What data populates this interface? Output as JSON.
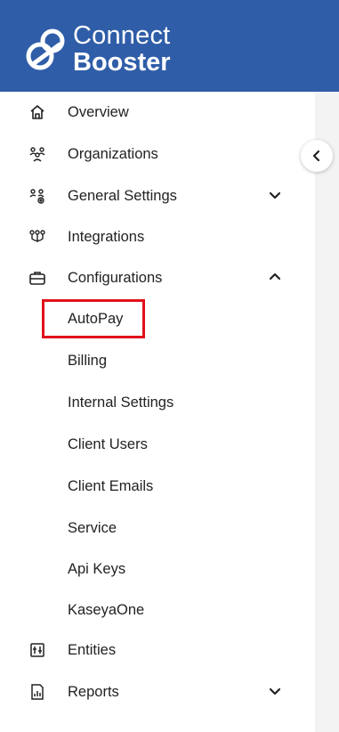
{
  "brand": {
    "line1": "Connect",
    "line2": "Booster"
  },
  "nav": {
    "overview": "Overview",
    "organizations": "Organizations",
    "general_settings": "General Settings",
    "integrations": "Integrations",
    "configurations": "Configurations",
    "entities": "Entities",
    "reports": "Reports"
  },
  "config_sub": [
    "AutoPay",
    "Billing",
    "Internal Settings",
    "Client Users",
    "Client Emails",
    "Service",
    "Api Keys",
    "KaseyaOne"
  ],
  "colors": {
    "header": "#2f5da8",
    "highlight": "#e0121b"
  }
}
